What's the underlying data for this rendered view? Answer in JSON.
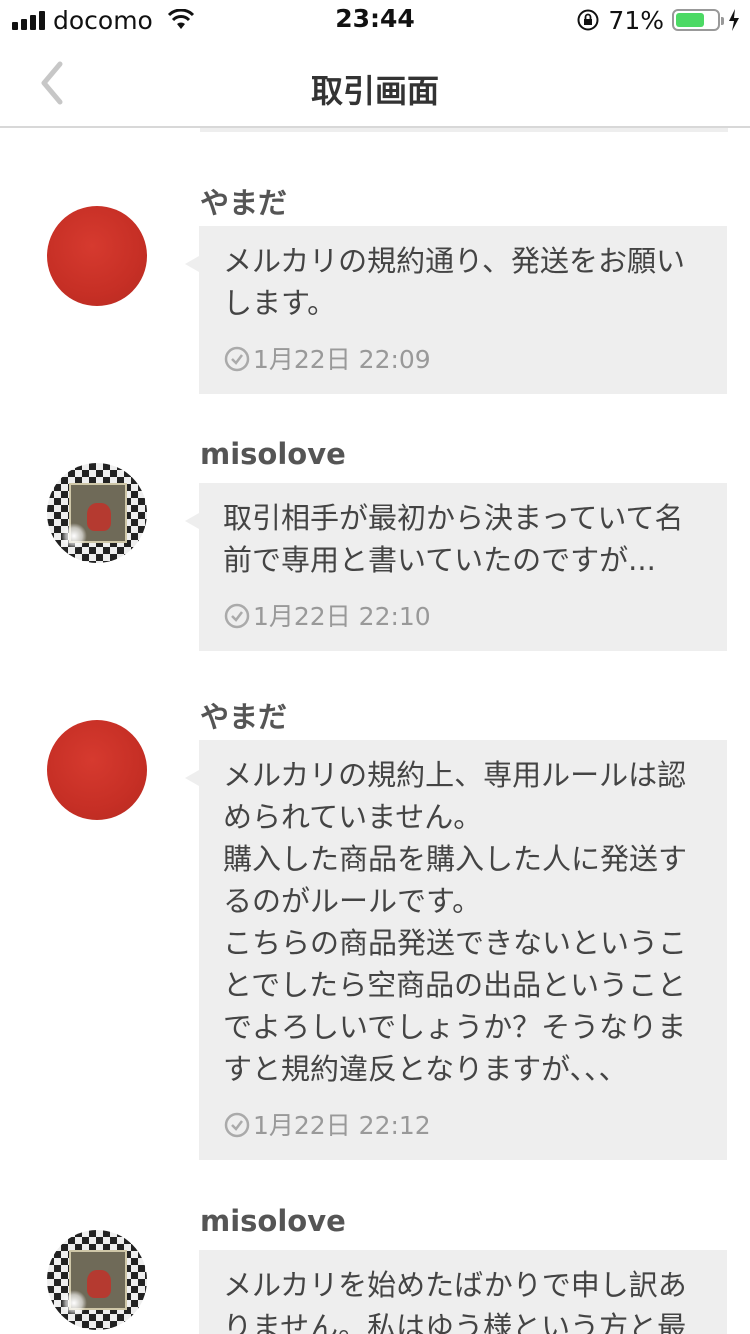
{
  "status_bar": {
    "carrier": "docomo",
    "time": "23:44",
    "battery_percent": "71%",
    "battery_level": 0.71
  },
  "nav": {
    "title": "取引画面",
    "back_icon": "chevron-left-icon"
  },
  "messages": [
    {
      "sender": "やまだ",
      "avatar": "red-circle-avatar",
      "text": "メルカリの規約通り、発送をお願い\nします。",
      "timestamp": "1月22日 22:09"
    },
    {
      "sender": "misolove",
      "avatar": "photo-avatar",
      "text": "取引相手が最初から決まっていて名\n前で専用と書いていたのですが...",
      "timestamp": "1月22日 22:10"
    },
    {
      "sender": "やまだ",
      "avatar": "red-circle-avatar",
      "text": "メルカリの規約上、専用ルールは認\nめられていません。\n購入した商品を購入した人に発送す\nるのがルールです。\nこちらの商品発送できないというこ\nとでしたら空商品の出品ということ\nでよろしいでしょうか？そうなりま\nすと規約違反となりますが、、、",
      "timestamp": "1月22日 22:12"
    },
    {
      "sender": "misolove",
      "avatar": "photo-avatar",
      "text": "メルカリを始めたばかりで申し訳あ\nりません。私はゆう様という方と最",
      "timestamp": ""
    }
  ]
}
